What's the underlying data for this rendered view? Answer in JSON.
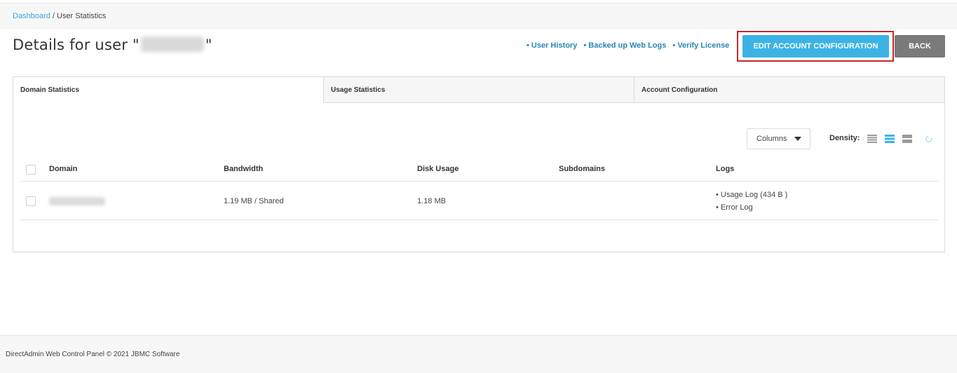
{
  "breadcrumb": {
    "home": "Dashboard",
    "separator": " / ",
    "current": "User Statistics"
  },
  "page": {
    "title_prefix": "Details for user \"",
    "title_suffix": "\""
  },
  "header_links": [
    "• User History",
    "• Backed up Web Logs",
    "• Verify License"
  ],
  "buttons": {
    "edit": "EDIT ACCOUNT CONFIGURATION",
    "back": "BACK"
  },
  "tabs": [
    "Domain Statistics",
    "Usage Statistics",
    "Account Configuration"
  ],
  "toolbar": {
    "columns": "Columns",
    "density": "Density:"
  },
  "table": {
    "headers": [
      "Domain",
      "Bandwidth",
      "Disk Usage",
      "Subdomains",
      "Logs"
    ],
    "rows": [
      {
        "bandwidth": "1.19 MB / Shared",
        "disk": "1.18 MB",
        "subdomains": "",
        "logs": [
          "• Usage Log (434 B )",
          "• Error Log"
        ]
      }
    ]
  },
  "footer": "DirectAdmin Web Control Panel © 2021 JBMC Software",
  "colors": {
    "accent": "#3cb3e4",
    "link": "#2a87b5",
    "highlight": "#c1272d",
    "back": "#7a7a7a"
  }
}
